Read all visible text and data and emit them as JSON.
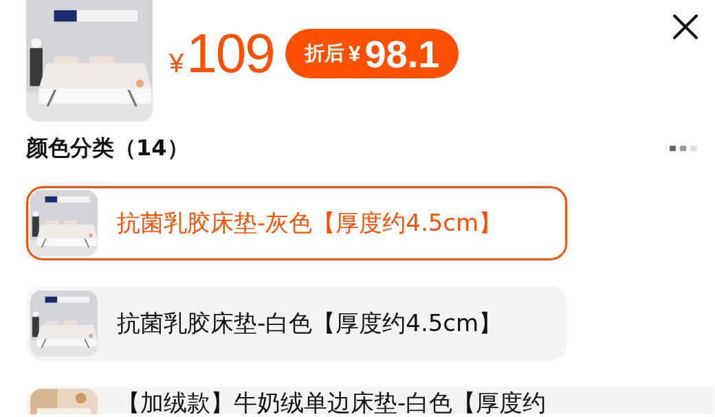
{
  "product": {
    "currency": "¥",
    "price": "109",
    "discount": {
      "label": "折后",
      "currency": "¥",
      "price": "98.1"
    }
  },
  "section": {
    "title": "颜色分类（14）"
  },
  "options": [
    {
      "label": "抗菌乳胶床垫-灰色【厚度约4.5cm】",
      "selected": true
    },
    {
      "label": "抗菌乳胶床垫-白色【厚度约4.5cm】",
      "selected": false
    },
    {
      "label": "【加绒款】牛奶绒单边床垫-白色【厚度约",
      "selected": false
    }
  ]
}
